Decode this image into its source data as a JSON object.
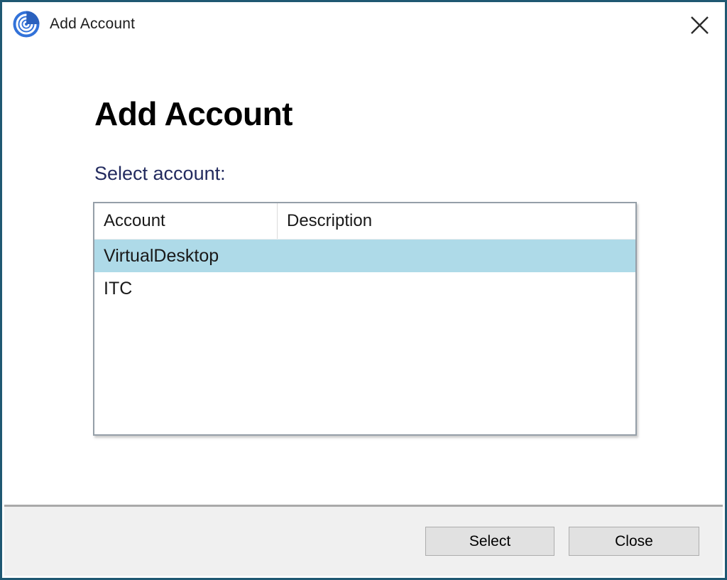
{
  "titlebar": {
    "title": "Add Account",
    "icons": {
      "app": "spiral-logo",
      "close": "✕"
    }
  },
  "content": {
    "heading": "Add Account",
    "select_label": "Select account:"
  },
  "table": {
    "columns": [
      "Account",
      "Description"
    ],
    "rows": [
      {
        "account": "VirtualDesktop",
        "description": "",
        "selected": true
      },
      {
        "account": "ITC",
        "description": "",
        "selected": false
      }
    ]
  },
  "footer": {
    "select_button": "Select",
    "close_button": "Close"
  },
  "colors": {
    "window_border": "#1F5872",
    "selected_row": "#AEDAE8",
    "footer_bg": "#F0F0F0",
    "footer_divider": "#A9A9A9",
    "button_bg": "#E1E1E1",
    "button_border": "#ADADAD",
    "subheading_text": "#232B5F",
    "table_border": "#959FA8",
    "app_icon_blue": "#3272D9",
    "app_icon_dark_wedge": "#2A61BE"
  }
}
